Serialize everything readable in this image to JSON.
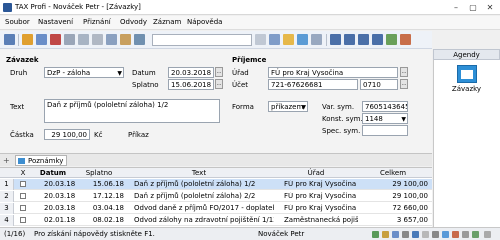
{
  "window": {
    "title": "TAX Profi - Nováček Petr - [Závazky]"
  },
  "menu": [
    "Soubor",
    "Nastavení",
    "Přiznání",
    "Odvody",
    "Záznam",
    "Nápověda"
  ],
  "form": {
    "section_zavazek": "Závazek",
    "section_prijemce": "Příjemce",
    "druh_label": "Druh",
    "druh_value": "DzP - záloha",
    "datum_label": "Datum",
    "datum_value": "20.03.2018",
    "splatno_label": "Splatno",
    "splatno_value": "15.06.2018",
    "urad_label": "Úřad",
    "urad_value": "FÚ pro Kraj Vysočina",
    "ucet_label": "Účet",
    "ucet_value": "721-67626681",
    "ucet_code": "0710",
    "text_label": "Text",
    "text_value": "Daň z příjmů (pololetní záloha) 1/2",
    "forma_label": "Forma",
    "forma_value": "příkazem",
    "var_sym_label": "Var. sym.",
    "var_sym_value": "7605143645",
    "konst_sym_label": "Konst. sym.",
    "konst_sym_value": "1148",
    "spec_sym_label": "Spec. sym.",
    "spec_sym_value": "",
    "castka_label": "Částka",
    "castka_value": "29 100,00",
    "currency": "Kč",
    "prikaz_label": "Příkaz"
  },
  "tabs": {
    "plus": "+",
    "notes": "Poznámky"
  },
  "grid": {
    "headers": {
      "x": "X",
      "datum": "Datum",
      "splatno": "Splatno",
      "text": "Text",
      "urad": "Úřad",
      "celkem": "Celkem"
    },
    "rows": [
      {
        "num": "1",
        "datum": "20.03.18",
        "splatno": "15.06.18",
        "text": "Daň z příjmů (pololetní záloha) 1/2",
        "urad": "FÚ pro Kraj Vysočina",
        "celkem": "29 100,00"
      },
      {
        "num": "2",
        "datum": "20.03.18",
        "splatno": "17.12.18",
        "text": "Daň z příjmů (pololetní záloha) 2/2",
        "urad": "FÚ pro Kraj Vysočina",
        "celkem": "29 100,00"
      },
      {
        "num": "3",
        "datum": "20.03.18",
        "splatno": "03.04.18",
        "text": "Odvod daně z příjmů FO/2017 - doplatek",
        "urad": "FÚ pro Kraj Vysočina",
        "celkem": "72 660,00"
      },
      {
        "num": "4",
        "datum": "02.01.18",
        "splatno": "08.02.18",
        "text": "Odvod zálohy na zdravotní pojištění 1/12",
        "urad": "Zaměstnanecká pojišťovna",
        "celkem": "3 657,00"
      }
    ]
  },
  "side": {
    "header": "Agendy",
    "item": "Závazky"
  },
  "status": {
    "position": "(1/16)",
    "hint": "Pro získání nápovědy stiskněte F1.",
    "user": "Nováček Petr"
  }
}
